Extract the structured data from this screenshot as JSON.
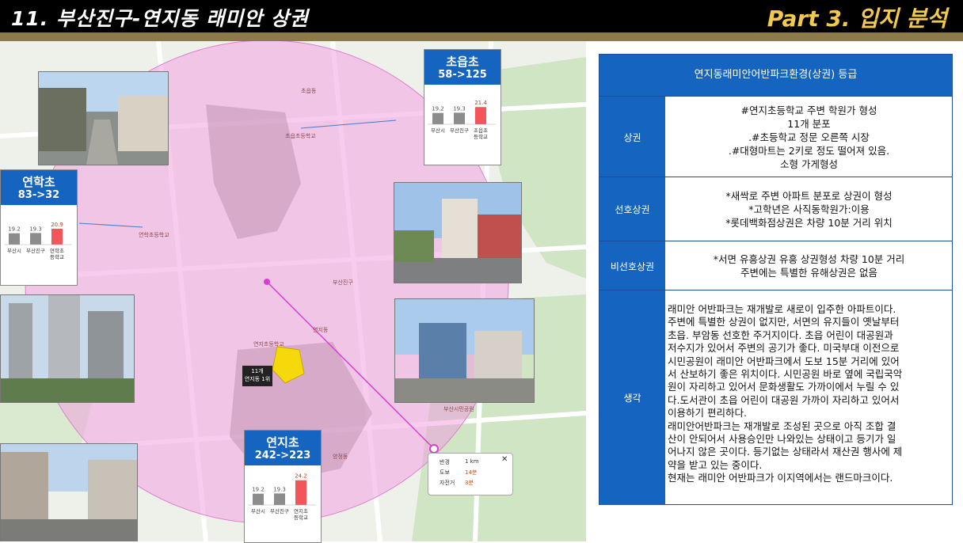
{
  "header": {
    "title": "11.   부산진구-연지동 래미안 상권",
    "part_title": "Part 3. 입지 분석"
  },
  "colors": {
    "header_bg": "#000000",
    "gold_bar": "#8d7a4b",
    "part_text": "#f2c94c",
    "accent_blue": "#1565c0",
    "radius_pink": "#f2b6e6",
    "bar_gray": "#8c8c8c",
    "bar_red": "#f2555a"
  },
  "map": {
    "place_labels": [
      "초읍초등학교",
      "연지초등학교",
      "연학초등학교",
      "부산진구",
      "부산시민공원",
      "연지동",
      "양정동",
      "초읍동"
    ],
    "complex_marker": {
      "line1": "11개",
      "line2": "연지동 1위"
    },
    "distance_popup": {
      "rows": [
        {
          "label": "반경",
          "value": "1 km"
        },
        {
          "label": "도보",
          "value": "14분"
        },
        {
          "label": "자전거",
          "value": "3분"
        }
      ],
      "close_icon": "close-icon"
    }
  },
  "schools": [
    {
      "name": "초읍초",
      "count": "58->125",
      "chart_data": {
        "type": "bar",
        "categories": [
          "부산시",
          "부산진구",
          "초읍초등학교"
        ],
        "values": [
          19.2,
          19.3,
          21.4
        ],
        "value_labels": [
          "19.2",
          "19.3",
          "21.4"
        ],
        "highlight_index": 2
      }
    },
    {
      "name": "연학초",
      "count": "83->32",
      "chart_data": {
        "type": "bar",
        "categories": [
          "부산시",
          "부산진구",
          "연학초등학교"
        ],
        "values": [
          19.2,
          19.3,
          20.9
        ],
        "value_labels": [
          "19.2",
          "19.3",
          "20.9"
        ],
        "highlight_index": 2
      }
    },
    {
      "name": "연지초",
      "count": "242->223",
      "chart_data": {
        "type": "bar",
        "categories": [
          "부산시",
          "부산진구",
          "연지초등학교"
        ],
        "values": [
          19.2,
          19.3,
          24.2
        ],
        "value_labels": [
          "19.2",
          "19.3",
          "24.2"
        ],
        "highlight_index": 2
      }
    }
  ],
  "grade": {
    "title": "연지동래미안어반파크환경(상권) 등급",
    "rows": [
      {
        "label": "상권",
        "lines": [
          "#연지초등학교 주변 학원가 형성",
          "11개 분포",
          ".#초등학교 정문 오른쪽 시장",
          ".#대형마트는 2키로 정도 떨어져 있음.",
          "소형 가게형성"
        ]
      },
      {
        "label": "선호상권",
        "lines": [
          "*새싹로 주변 아파트 분포로 상권이 형성",
          "*고학년은 사직동학원가:이용",
          "*롯데백화점상권은 차량 10분 거리 위치"
        ]
      },
      {
        "label": "비선호상권",
        "lines": [
          "*서면 유흥상권 유흥 상권형성 차량 10분 거리",
          "주변에는 특별한 유해상권은 없음"
        ]
      },
      {
        "label": "생각",
        "lines": [
          "래미안 어반파크는 재개발로 새로이 입주한 아파트이다.",
          "주변에 특별한 상권이 없지만, 서면의 유지들이 옛날부터",
          "초읍. 부암동 선호한 주거지이다. 초읍 어린이 대공원과",
          "저수지가 있어서 주변의 공기가 좋다. 미국부대 이전으로",
          "시민공원이 래미안 어반파크에서 도보 15분 거리에 있어",
          "서 산보하기 좋은 위치이다. 시민공원 바로 옆에 국립국악",
          "원이 자리하고 있어서 문화생활도 가까이에서 누릴 수 있",
          "다.도서관이 초읍 어린이 대공원 가까이 자리하고 있어서",
          "이용하기 편리하다.",
          "래미안어반파크는 재개발로 조성된 곳으로 아직 조합 결",
          "산이 안되어서 사용승인만 나와있는 상태이고 등기가 일",
          "어나지 않은 곳이다. 등기없는 상태라서 재산권 행사에 제",
          "약을 받고 있는 중이다.",
          "현재는 래미안 어반파크가 이지역에서는 랜드마크이다."
        ]
      }
    ]
  }
}
